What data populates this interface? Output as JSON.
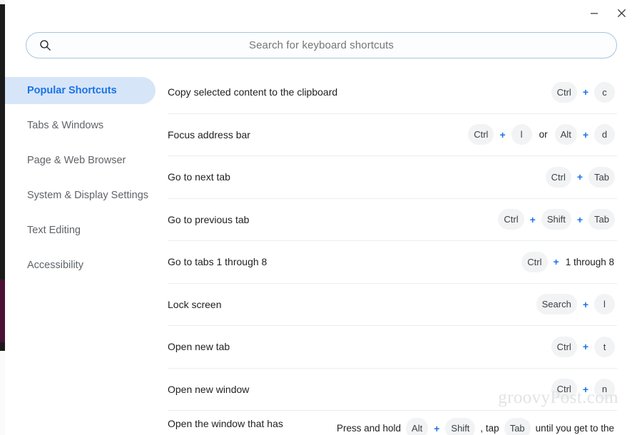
{
  "window": {
    "minimize_label": "–",
    "close_label": "×",
    "minimize_icon": "minimize-icon",
    "close_icon": "close-icon"
  },
  "search": {
    "placeholder": "Search for keyboard shortcuts",
    "value": "",
    "icon": "search-icon"
  },
  "sidebar": {
    "items": [
      {
        "label": "Popular Shortcuts",
        "selected": true
      },
      {
        "label": "Tabs & Windows",
        "selected": false
      },
      {
        "label": "Page & Web Browser",
        "selected": false
      },
      {
        "label": "System & Display Settings",
        "selected": false
      },
      {
        "label": "Text Editing",
        "selected": false
      },
      {
        "label": "Accessibility",
        "selected": false
      }
    ]
  },
  "shortcuts": {
    "rows": [
      {
        "label": "Copy selected content to the clipboard",
        "keys": [
          {
            "type": "key",
            "text": "Ctrl"
          },
          {
            "type": "plus",
            "text": "+"
          },
          {
            "type": "key",
            "text": "c"
          }
        ]
      },
      {
        "label": "Focus address bar",
        "keys": [
          {
            "type": "key",
            "text": "Ctrl"
          },
          {
            "type": "plus",
            "text": "+"
          },
          {
            "type": "key",
            "text": "l"
          },
          {
            "type": "or",
            "text": "or"
          },
          {
            "type": "key",
            "text": "Alt"
          },
          {
            "type": "plus",
            "text": "+"
          },
          {
            "type": "key",
            "text": "d"
          }
        ]
      },
      {
        "label": "Go to next tab",
        "keys": [
          {
            "type": "key",
            "text": "Ctrl"
          },
          {
            "type": "plus",
            "text": "+"
          },
          {
            "type": "key",
            "text": "Tab"
          }
        ]
      },
      {
        "label": "Go to previous tab",
        "keys": [
          {
            "type": "key",
            "text": "Ctrl"
          },
          {
            "type": "plus",
            "text": "+"
          },
          {
            "type": "key",
            "text": "Shift"
          },
          {
            "type": "plus",
            "text": "+"
          },
          {
            "type": "key",
            "text": "Tab"
          }
        ]
      },
      {
        "label": "Go to tabs 1 through 8",
        "keys": [
          {
            "type": "key",
            "text": "Ctrl"
          },
          {
            "type": "plus",
            "text": "+"
          },
          {
            "type": "plain",
            "text": "1 through 8"
          }
        ]
      },
      {
        "label": "Lock screen",
        "keys": [
          {
            "type": "key",
            "text": "Search"
          },
          {
            "type": "plus",
            "text": "+"
          },
          {
            "type": "key",
            "text": "l"
          }
        ]
      },
      {
        "label": "Open new tab",
        "keys": [
          {
            "type": "key",
            "text": "Ctrl"
          },
          {
            "type": "plus",
            "text": "+"
          },
          {
            "type": "key",
            "text": "t"
          }
        ]
      },
      {
        "label": "Open new window",
        "keys": [
          {
            "type": "key",
            "text": "Ctrl"
          },
          {
            "type": "plus",
            "text": "+"
          },
          {
            "type": "key",
            "text": "n"
          }
        ]
      },
      {
        "label": "Open the window that has",
        "partial": true,
        "keys": [
          {
            "type": "plain",
            "text": "Press and hold"
          },
          {
            "type": "key",
            "text": "Alt"
          },
          {
            "type": "plus",
            "text": "+"
          },
          {
            "type": "key",
            "text": "Shift"
          },
          {
            "type": "plain",
            "text": ", tap"
          },
          {
            "type": "key",
            "text": "Tab"
          },
          {
            "type": "plain",
            "text": "until you get to the"
          }
        ]
      }
    ]
  },
  "watermark": {
    "text": "groovyPost.com"
  },
  "colors": {
    "accent": "#1a73e8",
    "selected_bg": "#d7e5f8",
    "keycap_bg": "#f1f3f4",
    "text": "#202124",
    "muted_text": "#5f6368",
    "search_border": "#a9c5de",
    "divider": "#eceded"
  }
}
